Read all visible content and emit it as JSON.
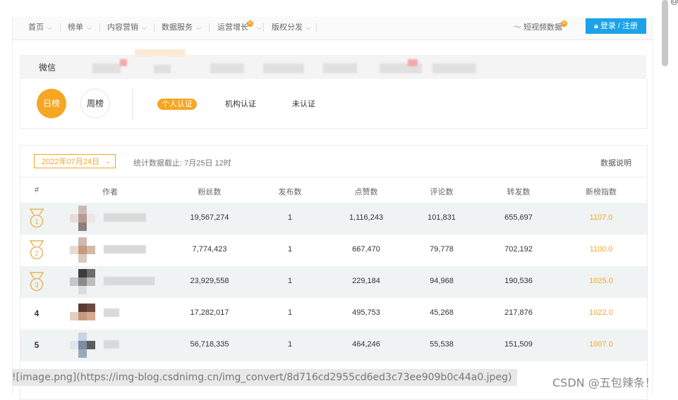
{
  "nav": {
    "items": [
      {
        "label": "首页",
        "has_badge": false
      },
      {
        "label": "榜单",
        "has_badge": false
      },
      {
        "label": "内容营销",
        "has_badge": false
      },
      {
        "label": "数据服务",
        "has_badge": false
      },
      {
        "label": "运营增长",
        "has_badge": true
      },
      {
        "label": "版权分发",
        "has_badge": false
      }
    ],
    "badge": "N",
    "video_data": "短视频数据",
    "video_badge": "N",
    "login": "登录 / 注册"
  },
  "platform": {
    "label": "微信"
  },
  "filters": {
    "day": "日榜",
    "week": "周榜",
    "cert_personal": "个人认证",
    "cert_org": "机构认证",
    "cert_none": "未认证"
  },
  "toolbar": {
    "date": "2022年07月24日",
    "stat_note": "统计数据截止: 7月25日 12时",
    "data_desc": "数据说明"
  },
  "table": {
    "columns": [
      "#",
      "作者",
      "粉丝数",
      "发布数",
      "点赞数",
      "评论数",
      "转发数",
      "新榜指数"
    ],
    "rows": [
      {
        "rank": "1",
        "fans": "19,567,274",
        "posts": "1",
        "likes": "1,116,243",
        "comments": "101,831",
        "shares": "655,697",
        "index": "1107.0"
      },
      {
        "rank": "2",
        "fans": "7,774,423",
        "posts": "1",
        "likes": "667,470",
        "comments": "79,778",
        "shares": "702,192",
        "index": "1100.0"
      },
      {
        "rank": "3",
        "fans": "23,929,558",
        "posts": "1",
        "likes": "229,184",
        "comments": "94,968",
        "shares": "190,536",
        "index": "1025.0"
      },
      {
        "rank": "4",
        "fans": "17,282,017",
        "posts": "1",
        "likes": "495,753",
        "comments": "45,268",
        "shares": "217,876",
        "index": "1022.0"
      },
      {
        "rank": "5",
        "fans": "56,718,335",
        "posts": "1",
        "likes": "464,246",
        "comments": "55,538",
        "shares": "151,509",
        "index": "1007.0"
      }
    ]
  },
  "overlay": {
    "markdown": "![image.png](https://img-blog.csdnimg.cn/img_convert/8d716cd2955cd6ed3c73ee909b0c44a0.jpeg)",
    "watermark": "CSDN @五包辣条！"
  },
  "colors": {
    "accent": "#f5a623",
    "login": "#1aa3e8",
    "row_alt": "#eff3f3"
  }
}
